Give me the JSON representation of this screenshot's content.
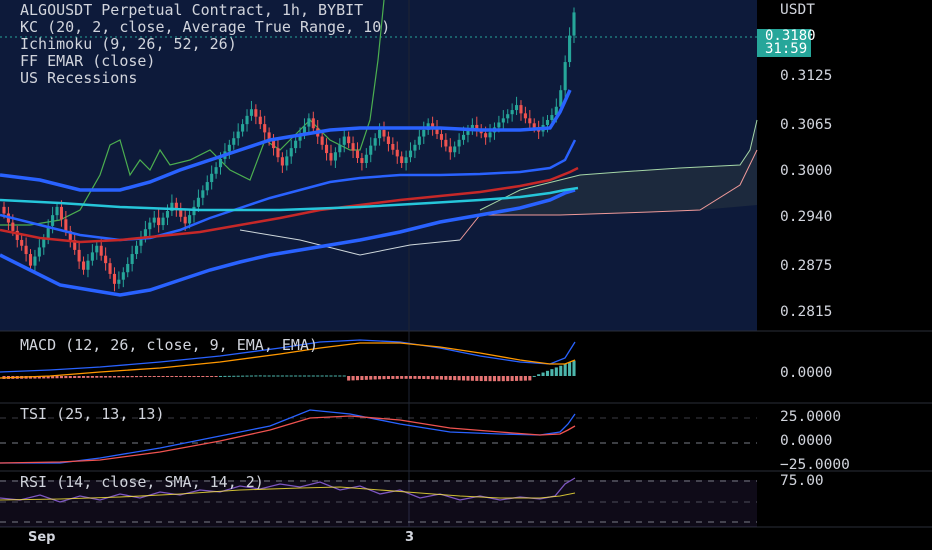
{
  "main": {
    "title": "ALGOUSDT Perpetual Contract, 1h, BYBIT",
    "indicators": [
      "KC (20, 2, close, Average True Range, 10)",
      "Ichimoku (9, 26, 52, 26)",
      "FF EMAR (close)",
      "US Recessions"
    ],
    "currency": "USDT",
    "price_ticks": [
      "0.3125",
      "0.3065",
      "0.3000",
      "0.2940",
      "0.2875",
      "0.2815"
    ],
    "last_price": "0.3180",
    "countdown": "31:59",
    "colors": {
      "up": "#26a69a",
      "down": "#ef5350",
      "band": "#2962ff",
      "background": "#0d1a3a",
      "ema_slow": "#26c6da",
      "ema_mid": "#c62828"
    }
  },
  "macd": {
    "label": "MACD (12, 26, close, 9, EMA, EMA)",
    "ticks": [
      "0.0000"
    ]
  },
  "tsi": {
    "label": "TSI (25, 13, 13)",
    "ticks": [
      "25.0000",
      "0.0000",
      "−25.0000"
    ]
  },
  "rsi": {
    "label": "RSI (14, close, SMA, 14, 2)",
    "ticks": [
      "75.00"
    ]
  },
  "time_axis": {
    "labels": [
      "Sep",
      "3"
    ]
  },
  "chart_data": {
    "type": "candlestick",
    "title": "ALGOUSDT Perpetual Contract, 1h, BYBIT",
    "ylim": [
      0.2795,
      0.3195
    ],
    "close": [
      0.2937,
      0.2926,
      0.2916,
      0.2905,
      0.2898,
      0.2888,
      0.2874,
      0.2885,
      0.2896,
      0.2906,
      0.2922,
      0.2935,
      0.2945,
      0.293,
      0.2916,
      0.2905,
      0.2893,
      0.2879,
      0.2869,
      0.288,
      0.289,
      0.2898,
      0.2886,
      0.2877,
      0.2864,
      0.2852,
      0.2857,
      0.2866,
      0.2876,
      0.2888,
      0.2898,
      0.2908,
      0.2918,
      0.2926,
      0.2932,
      0.2923,
      0.2932,
      0.294,
      0.295,
      0.2942,
      0.2933,
      0.2925,
      0.2935,
      0.2945,
      0.2956,
      0.2965,
      0.2975,
      0.2985,
      0.2993,
      0.3003,
      0.3012,
      0.302,
      0.3028,
      0.3036,
      0.3045,
      0.3055,
      0.3063,
      0.3054,
      0.3045,
      0.3035,
      0.3025,
      0.3016,
      0.3005,
      0.2995,
      0.3006,
      0.3016,
      0.3025,
      0.3033,
      0.3042,
      0.3052,
      0.304,
      0.303,
      0.302,
      0.301,
      0.3001,
      0.3011,
      0.302,
      0.303,
      0.3022,
      0.3013,
      0.3004,
      0.2998,
      0.3008,
      0.3019,
      0.3028,
      0.3038,
      0.303,
      0.3021,
      0.3014,
      0.3006,
      0.2998,
      0.3005,
      0.3013,
      0.302,
      0.303,
      0.3038,
      0.3046,
      0.304,
      0.3033,
      0.3026,
      0.3018,
      0.3011,
      0.3018,
      0.3026,
      0.3032,
      0.3038,
      0.3044,
      0.3039,
      0.3034,
      0.3029,
      0.3035,
      0.3041,
      0.3047,
      0.3052,
      0.3057,
      0.3062,
      0.3068,
      0.3058,
      0.3052,
      0.3046,
      0.3041,
      0.3036,
      0.3044,
      0.305,
      0.3056,
      0.3066,
      0.3086,
      0.312,
      0.3152,
      0.318
    ],
    "up_color": "#26a69a",
    "down_color": "#ef5350"
  }
}
